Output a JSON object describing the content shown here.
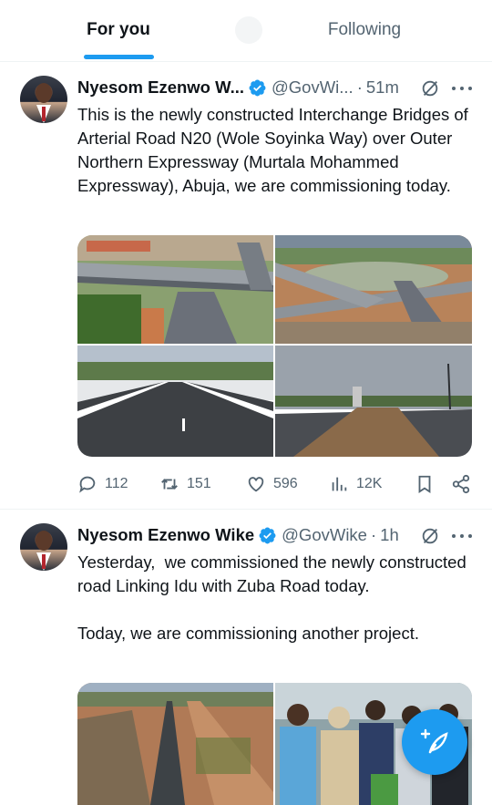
{
  "tabs": {
    "for_you": "For you",
    "following": "Following"
  },
  "tweets": [
    {
      "name": "Nyesom Ezenwo W...",
      "handle": "@GovWi...",
      "separator": "·",
      "time": "51m",
      "text": "This is the newly constructed Interchange Bridges of Arterial Road N20 (Wole Soyinka Way) over Outer Northern Expressway (Murtala Mohammed Expressway), Abuja, we are commissioning today.",
      "stats": {
        "replies": "112",
        "retweets": "151",
        "likes": "596",
        "views": "12K"
      }
    },
    {
      "name": "Nyesom Ezenwo Wike",
      "handle": "@GovWike",
      "separator": "·",
      "time": "1h",
      "text": "Yesterday,  we commissioned the newly constructed road Linking Idu with Zuba Road today.\n\nToday, we are commissioning another project."
    }
  ],
  "icons": {
    "verified": "verified-badge-icon",
    "grok": "grok-icon",
    "more": "more-icon",
    "reply": "reply-icon",
    "retweet": "retweet-icon",
    "like": "like-icon",
    "views": "views-icon",
    "bookmark": "bookmark-icon",
    "share": "share-icon",
    "compose": "compose-icon"
  },
  "colors": {
    "accent": "#1d9bf0",
    "text": "#0f1419",
    "secondary": "#536471"
  }
}
